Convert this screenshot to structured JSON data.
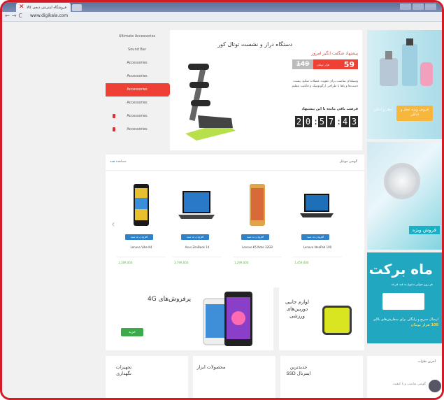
{
  "browser": {
    "tab_title": "فروشگاه اینترنتی دیجی کالا",
    "url": "www.digikala.com"
  },
  "categories": [
    {
      "label": "Ultimate Accessories"
    },
    {
      "label": "Sound Bar"
    },
    {
      "label": "Accessories"
    },
    {
      "label": "Accessories"
    },
    {
      "label": "Accessories",
      "active": true
    },
    {
      "label": "Accessories"
    },
    {
      "label": "Accessories"
    },
    {
      "label": "Accessories"
    }
  ],
  "offer": {
    "label": "پیشنهاد شگفت انگیز امروز",
    "title": "دستگاه دراز و نشست توتال کور",
    "old_price": "149",
    "new_price": "59",
    "price_unit": "هزار تومان",
    "description": "وسیله‌ای مناسب برای تقویت عضلات شکم، پشت، دست‌ها و پاها با طراحی ارگونومیک و قابلیت تنظیم",
    "timer_label": "فرصت باقی مانده تا این پیشنهاد",
    "timer": [
      "2",
      "0",
      ":",
      "5",
      "7",
      ":",
      "4",
      "3"
    ]
  },
  "banners": {
    "perfume_gift": "عطر و ادکلن",
    "perfume_sale": "فروش ویژه عطر و ادکلن",
    "watch_tag": "فروش ویژه",
    "mahe_barakat_title": "ماه برکت",
    "mahe_barakat_sub": "هر روز جوایز متنوع به قید قرعه",
    "mahe_barakat_text_1": "ارسال سریع و رایگان",
    "mahe_barakat_text_2": "برای سفارش‌های بالای",
    "mahe_barakat_text_3": "100 هزار تومان",
    "comment_head": "آخرین نظرات",
    "comment_line": "گوشی مناسب و با کیفیت"
  },
  "carousel": {
    "head_right": "گوشی موبایل",
    "head_left": "مشاهده همه",
    "products": [
      {
        "name": "Lenovo IdeaPad 100",
        "badge": "افزودن به سبد",
        "price": "1,459,000"
      },
      {
        "name": "Lenovo K5 Note 32GB",
        "badge": "افزودن به سبد",
        "price": "1,299,000"
      },
      {
        "name": "Asus ZenBook 14",
        "badge": "افزودن به سبد",
        "price": "3,799,000"
      },
      {
        "name": "Lenovo Vibe K4",
        "badge": "افزودن به سبد",
        "price": "1,189,000"
      }
    ]
  },
  "promo": {
    "fourg_title": "پرفروش‌های 4G",
    "fourg_button": "خرید",
    "sport_title": "لوازم جانبی دوربین‌های ورزشی"
  },
  "bottom": [
    {
      "title": "جدیدترین اینترنال SSD"
    },
    {
      "title": "محصولات ابزار"
    },
    {
      "title": "تجهیزات نگهداری"
    }
  ],
  "colors": {
    "accent": "#ef4036",
    "frame_border": "#d11c26",
    "link_blue": "#2f82c7",
    "buy_green": "#3aaa4a"
  }
}
